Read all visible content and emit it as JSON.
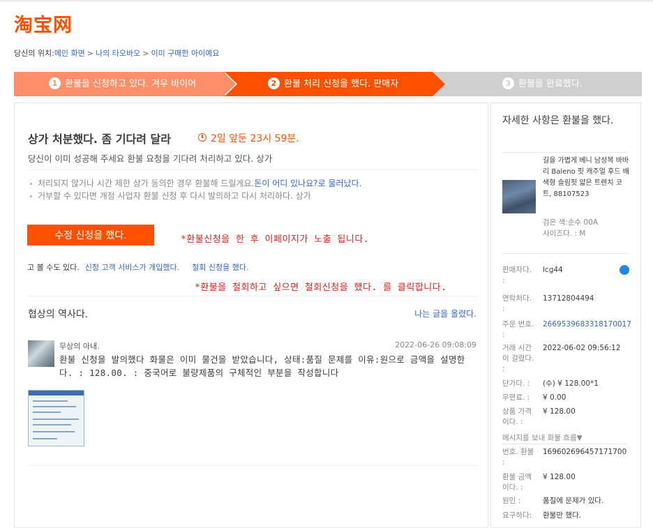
{
  "logo": "淘宝网",
  "breadcrumb": {
    "prefix": "당신의 위치:",
    "items": [
      "메인 화면",
      "나의 타오바오",
      "이미 구매한 아이예요"
    ],
    "separator": ">"
  },
  "steps": [
    {
      "num": "1",
      "label": "환불을 신청하고 있다. 겨우 바이어"
    },
    {
      "num": "2",
      "label": "환불 처리 신청을 했다. 판매자"
    },
    {
      "num": "3",
      "label": "환불을 완료했다."
    }
  ],
  "status": {
    "title": "상가 처분했다. 좀 기다려 달라",
    "countdown": "2일 앞둔 23시 59분.",
    "description": "당신이 이미 성공해 주세요 환불 요청을 기다려 처리하고 있다. 상가",
    "tip1_text": "처리되지 않거나 시간 제한 상가 동의한 경우 환불해 드릴게요.",
    "tip1_link": "돈이 어디 있나요?로 물러났다.",
    "tip2_text": "거부할 수 있다면 개정 사업자 환불 신청 후 다시 발의하고 다시 처리하다. 상가"
  },
  "actions": {
    "modify_button": "수정 신청을 했다.",
    "note1": "*환불신청을 한 후  이페이지가 노출 됩니다.",
    "also_prefix": "고 볼 수도 있다.",
    "link_service": "신청 고객 서비스가 개입했다.",
    "link_withdraw": "철회 신청을 했다.",
    "note2": "*환불을 철회하고 싶으면 철회신청을 했다. 를 클릭합니다."
  },
  "history": {
    "title": "협상의 역사다.",
    "post_link": "나는 글을 올렸다.",
    "message": {
      "author": "무상의 아내.",
      "time": "2022-06-26 09:08:09",
      "body": "환불 신청을 발의했다 화물은 이미 물건을 받았습니다, 상태:품질 문제를 이유:원으로 금액을 설명한다. : 128.00. : 중국어로 불량제품의 구체적인 부분을 작성합니다"
    }
  },
  "sidebar": {
    "title": "자세한 사항은 환불을 했다.",
    "product": {
      "name": "길을 가볍게 베니 남성복 바바리 Baleno 핏 캐주얼 후드 배색형 슬림핏 얇은 트렌치 코트, 88107523",
      "color": "검은 색:순수 00A",
      "size": "사이즈다. : M"
    },
    "info": [
      {
        "key": "판매자다.   :",
        "value": "lcg44"
      },
      {
        "key": "연락처다.   :",
        "value": "13712804494"
      },
      {
        "key": "주문 번호.  :",
        "value": "2669539683318170017"
      },
      {
        "key": "거래 시간이 걸렸다. :",
        "value": "2022-06-02 09:56:12"
      },
      {
        "key": "단가다. :",
        "value": "(수) ¥ 128.00*1"
      },
      {
        "key": "우편료. :",
        "value": "¥ 0.00"
      },
      {
        "key": "상품 가격이다. :",
        "value": "¥ 128.00"
      }
    ],
    "flow_label": "메시지를 보내 화물 흐름▼",
    "refund_info": [
      {
        "key": "번호. 환불  :",
        "value": "169602696457171700"
      },
      {
        "key": "환불 금액이다. :",
        "value": "¥ 128.00"
      },
      {
        "key": "원인    :",
        "value": "품질에 문제가 있다."
      },
      {
        "key": "요구하다:",
        "value": "환불만 했다."
      }
    ]
  },
  "colors": {
    "brand": "#ff5000",
    "step_done": "#ff8f68",
    "step_todo": "#cfcfcf",
    "link": "#3366cc",
    "note_red": "#e0201a"
  }
}
